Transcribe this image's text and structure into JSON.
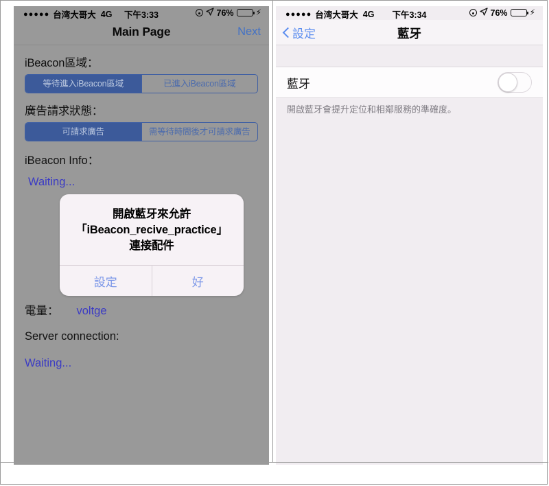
{
  "left_phone": {
    "status_bar": {
      "signal_dots": "●●●●●",
      "carrier": "台湾大哥大",
      "network": "4G",
      "time": "下午3:33",
      "alarm_icon": "alarm-icon",
      "location_icon": "location-arrow-icon",
      "battery_percent": "76%",
      "battery_level": 76,
      "charging_icon": "lightning-bolt-icon"
    },
    "nav": {
      "title": "Main Page",
      "right_button": "Next"
    },
    "sections": {
      "region_label": "iBeacon區域：",
      "region_segments": [
        {
          "label": "等待進入iBeacon區域",
          "selected": true
        },
        {
          "label": "已進入iBeacon區域",
          "selected": false
        }
      ],
      "ad_label": "廣告請求狀態：",
      "ad_segments": [
        {
          "label": "可請求廣告",
          "selected": true
        },
        {
          "label": "需等待時間後才可請求廣告",
          "selected": false
        }
      ],
      "info_label": "iBeacon Info：",
      "info_value": "Waiting...",
      "battery_label": "電量：",
      "battery_value": "voltge",
      "server_label": "Server connection:",
      "server_value": "Waiting..."
    },
    "alert": {
      "line1": "開啟藍牙來允許",
      "line2": "「iBeacon_recive_practice」",
      "line3": "連接配件",
      "buttons": [
        {
          "label": "設定"
        },
        {
          "label": "好"
        }
      ]
    }
  },
  "right_phone": {
    "status_bar": {
      "signal_dots": "●●●●●",
      "carrier": "台湾大哥大",
      "network": "4G",
      "time": "下午3:34",
      "alarm_icon": "alarm-icon",
      "location_icon": "location-arrow-icon",
      "battery_percent": "76%",
      "battery_level": 76,
      "charging_icon": "lightning-bolt-icon"
    },
    "nav": {
      "back_label": "設定",
      "back_icon": "chevron-left-icon",
      "title": "藍牙"
    },
    "bluetooth_row": {
      "label": "藍牙",
      "toggle_on": false
    },
    "footnote": "開啟藍牙會提升定位和相鄰服務的準確度。"
  },
  "colors": {
    "segment_selected_bg": "#3c5a9a",
    "segment_text_unselected": "#4b6bad",
    "link_blue": "#4472c4",
    "value_blue": "#3b3bc4",
    "ios_blue": "#5b8def",
    "battery_green": "#4cd964",
    "dimmed_bg": "#999999",
    "settings_bg": "#f1edf1"
  }
}
